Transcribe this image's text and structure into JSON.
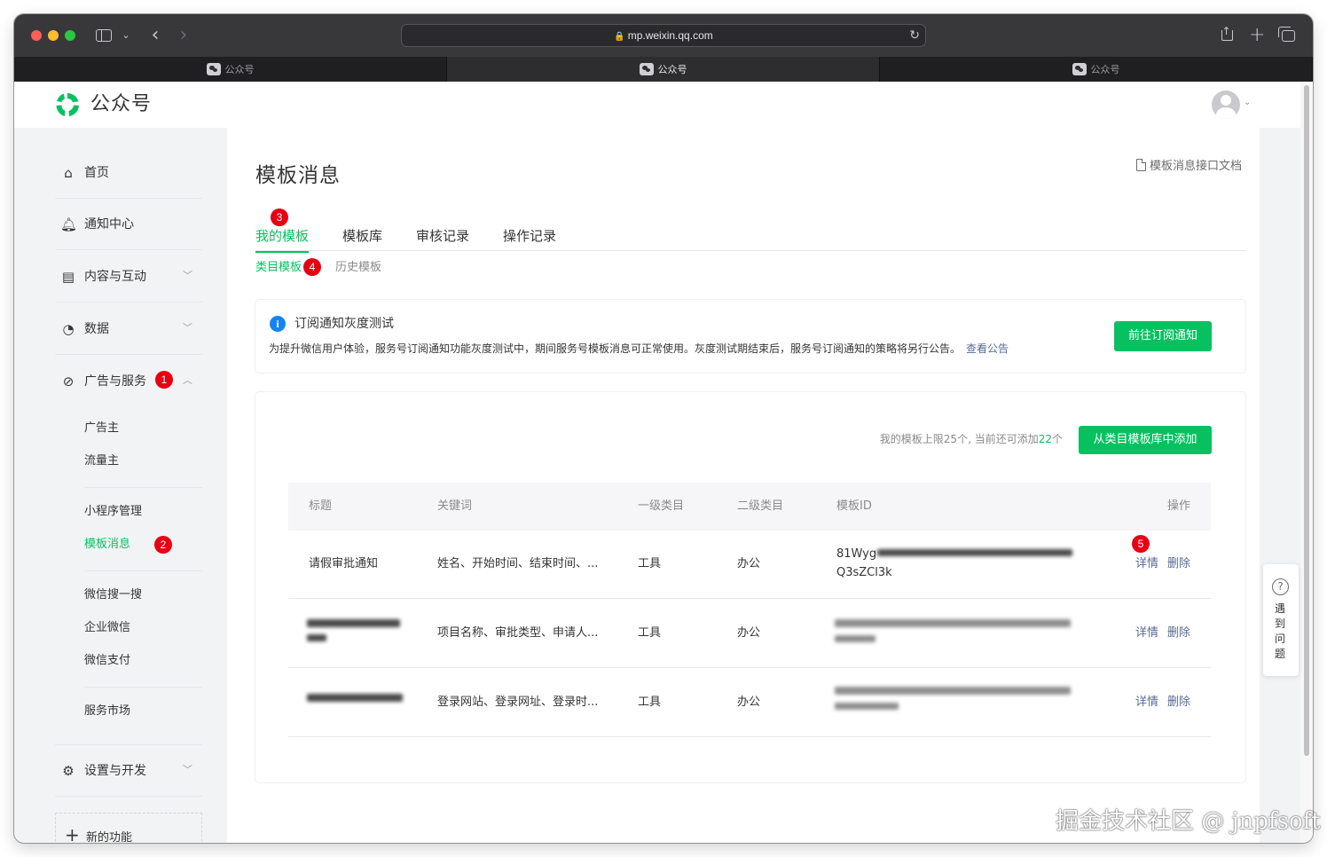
{
  "browser": {
    "url": "mp.weixin.qq.com",
    "tabs": [
      {
        "title": "公众号"
      },
      {
        "title": "公众号"
      },
      {
        "title": "公众号"
      }
    ]
  },
  "header": {
    "app_name": "公众号",
    "brand_color": "#07c160"
  },
  "nav": {
    "home": "首页",
    "notifications": "通知中心",
    "content": "内容与互动",
    "data": "数据",
    "ads": "广告与服务",
    "ads_badge": "1",
    "ads_items": {
      "advertiser": "广告主",
      "publisher": "流量主",
      "miniprogram": "小程序管理",
      "template": "模板消息",
      "template_badge": "2",
      "search": "微信搜一搜",
      "work_wechat": "企业微信",
      "pay": "微信支付",
      "market": "服务市场"
    },
    "settings": "设置与开发",
    "new_features": "新的功能"
  },
  "main": {
    "title": "模板消息",
    "doc_link": "模板消息接口文档",
    "tabs": {
      "my_templates": "我的模板",
      "my_templates_badge": "3",
      "library": "模板库",
      "review": "审核记录",
      "ops": "操作记录"
    },
    "subtabs": {
      "category": "类目模板",
      "category_badge": "4",
      "history": "历史模板"
    },
    "notice": {
      "title": "订阅通知灰度测试",
      "body": "为提升微信用户体验，服务号订阅通知功能灰度测试中，期间服务号模板消息可正常使用。灰度测试期结束后，服务号订阅通知的策略将另行公告。",
      "link": "查看公告",
      "button": "前往订阅通知"
    },
    "limit": {
      "prefix": "我的模板上限25个, 当前还可添加",
      "count": "22",
      "suffix": "个"
    },
    "add_button": "从类目模板库中添加",
    "table": {
      "headers": [
        "标题",
        "关键词",
        "一级类目",
        "二级类目",
        "模板ID",
        "操作"
      ],
      "rows": [
        {
          "title": "请假审批通知",
          "keywords": "姓名、开始时间、结束时间、...",
          "cat1": "工具",
          "cat2": "办公",
          "id_line1": "81Wyg",
          "id_line2": "Q3sZCl3k"
        },
        {
          "title": "",
          "keywords": "项目名称、审批类型、申请人...",
          "cat1": "工具",
          "cat2": "办公",
          "id_line1": "",
          "id_line2": ""
        },
        {
          "title": "",
          "keywords": "登录网站、登录网址、登录时...",
          "cat1": "工具",
          "cat2": "办公",
          "id_line1": "",
          "id_line2": ""
        }
      ],
      "action_badge": "5",
      "detail_label": "详情",
      "delete_label": "删除"
    }
  },
  "help": {
    "label": "遇到问题"
  },
  "watermark": "掘金技术社区 @ jnpfsoft"
}
